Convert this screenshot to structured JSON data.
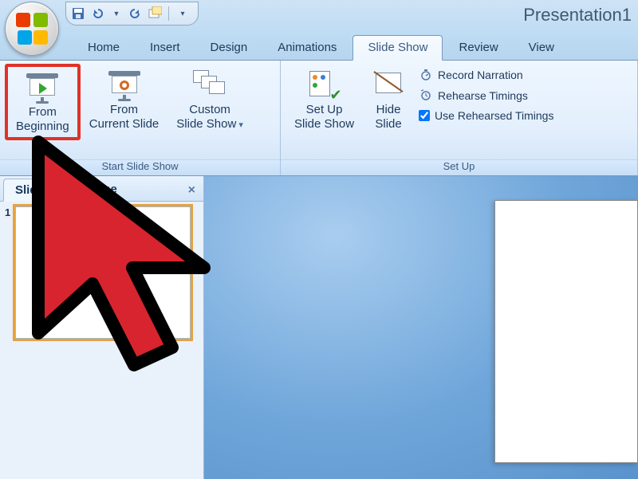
{
  "window": {
    "title": "Presentation1"
  },
  "qat": {
    "save": "save-icon",
    "undo": "undo-icon",
    "redo": "redo-icon",
    "repeat": "repeat-icon",
    "new_slide": "new-slide-icon",
    "customize": "customize-qat"
  },
  "tabs": {
    "items": [
      "Home",
      "Insert",
      "Design",
      "Animations",
      "Slide Show",
      "Review",
      "View"
    ],
    "active_index": 4
  },
  "ribbon": {
    "groups": [
      {
        "label": "Start Slide Show",
        "buttons": [
          {
            "key": "from-beginning",
            "label": "From\nBeginning",
            "highlighted": true
          },
          {
            "key": "from-current",
            "label": "From\nCurrent Slide"
          },
          {
            "key": "custom",
            "label": "Custom\nSlide Show",
            "dropdown": true
          }
        ]
      },
      {
        "label": "Set Up",
        "buttons": [
          {
            "key": "setup",
            "label": "Set Up\nSlide Show"
          },
          {
            "key": "hide",
            "label": "Hide\nSlide"
          }
        ],
        "list": [
          {
            "key": "record-narration",
            "label": "Record Narration",
            "icon": "stopwatch"
          },
          {
            "key": "rehearse-timings",
            "label": "Rehearse Timings",
            "icon": "clock-arrow"
          },
          {
            "key": "use-rehearsed",
            "label": "Use Rehearsed Timings",
            "checkbox": true,
            "checked": true
          }
        ]
      }
    ]
  },
  "panel": {
    "tabs": [
      "Slides",
      "Outline"
    ],
    "active": 0,
    "close": "×",
    "slides": [
      {
        "num": "1",
        "selected": true
      }
    ]
  },
  "annotation": {
    "cursor_color": "#d8242e"
  }
}
